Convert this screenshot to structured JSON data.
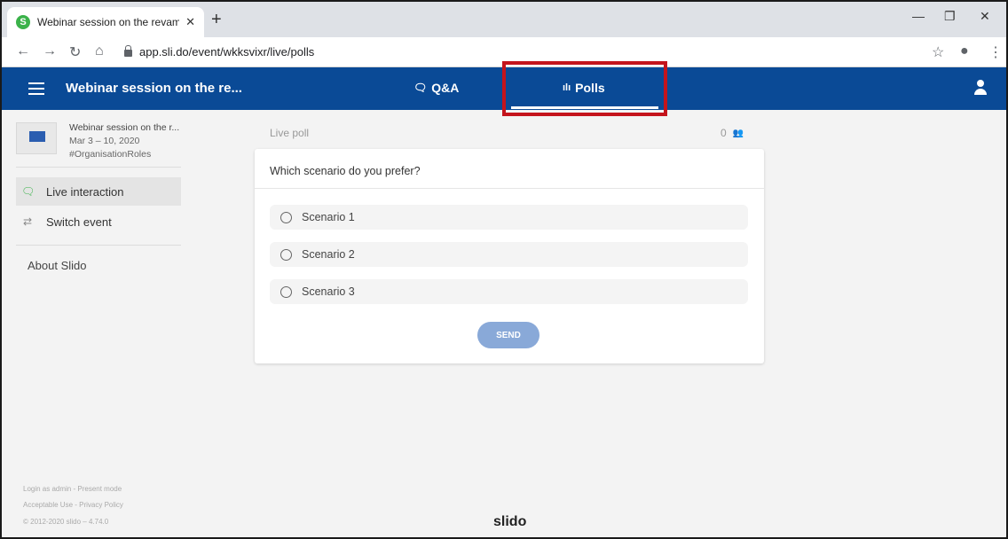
{
  "browser": {
    "tab_title": "Webinar session on the revampe",
    "favicon_letter": "S",
    "new_tab": "+",
    "url": "app.sli.do/event/wkksvixr/live/polls",
    "icons": [
      "back-arrow-icon",
      "forward-arrow-icon",
      "reload-icon",
      "home-icon",
      "lock-icon",
      "star-icon",
      "account-icon",
      "menu-dots-icon",
      "minimize-icon",
      "restore-icon",
      "close-icon"
    ]
  },
  "header": {
    "event_title": "Webinar session on the re...",
    "tabs": [
      {
        "label": "Q&A",
        "icon": "chat-bubbles-icon"
      },
      {
        "label": "Polls",
        "icon": "bar-chart-icon",
        "active": true
      }
    ],
    "accent": "#0a4a96",
    "highlight_color": "#c4141c"
  },
  "sidebar": {
    "event_name": "Webinar session on the r...",
    "event_dates": "Mar 3 – 10, 2020",
    "event_code": "#OrganisationRoles",
    "items": [
      {
        "label": "Live interaction",
        "icon": "chat-icon",
        "active": true
      },
      {
        "label": "Switch event",
        "icon": "switch-arrows-icon"
      }
    ],
    "about": "About Slido",
    "footer": {
      "line1": "Login as admin - Present mode",
      "line2": "Acceptable Use - Privacy Policy",
      "line3": "© 2012-2020 slido – 4.74.0"
    }
  },
  "poll": {
    "label": "Live poll",
    "participants": "0",
    "question": "Which scenario do you prefer?",
    "options": [
      "Scenario 1",
      "Scenario 2",
      "Scenario 3"
    ],
    "send_label": "SEND",
    "send_color": "#89a9d8"
  },
  "brand": "slido"
}
